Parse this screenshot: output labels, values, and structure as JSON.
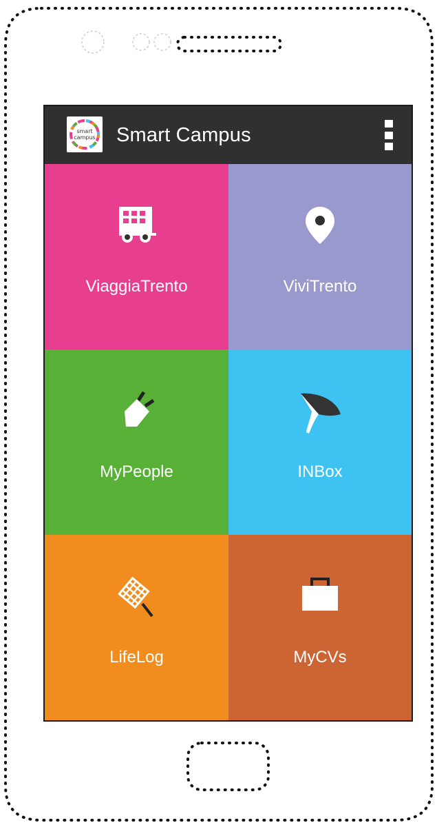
{
  "app": {
    "title": "Smart Campus",
    "logo_text_line1": "smart",
    "logo_text_line2": "campus"
  },
  "tiles": [
    {
      "label": "ViaggiaTrento",
      "icon": "bus-icon",
      "color": "#e73e8f"
    },
    {
      "label": "ViviTrento",
      "icon": "map-pin-icon",
      "color": "#9a99cd"
    },
    {
      "label": "MyPeople",
      "icon": "plug-icon",
      "color": "#58b037"
    },
    {
      "label": "INBox",
      "icon": "funnel-icon",
      "color": "#3ec2f1"
    },
    {
      "label": "LifeLog",
      "icon": "net-icon",
      "color": "#f18c1e"
    },
    {
      "label": "MyCVs",
      "icon": "briefcase-icon",
      "color": "#cc6433"
    }
  ],
  "colors": {
    "appbar": "#303030",
    "frame": "#1a1a1a"
  }
}
